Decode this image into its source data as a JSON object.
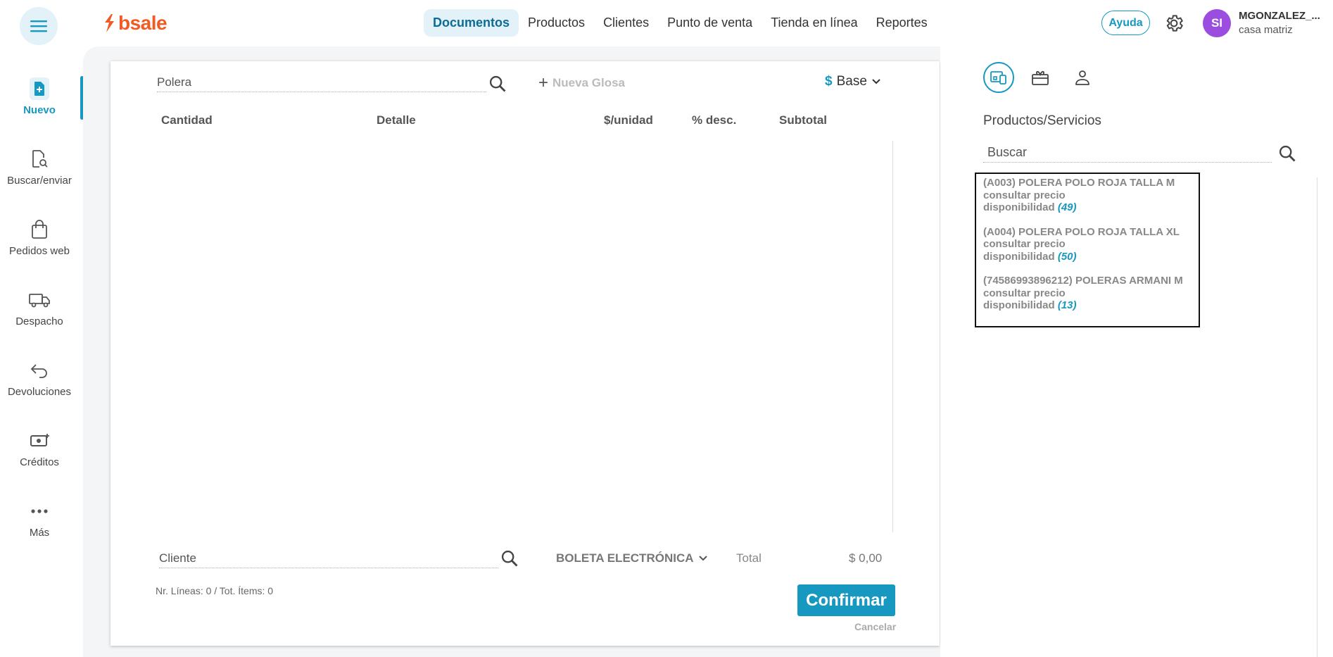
{
  "brand": {
    "name": "bsale"
  },
  "nav": {
    "items": [
      {
        "label": "Documentos",
        "active": true
      },
      {
        "label": "Productos"
      },
      {
        "label": "Clientes"
      },
      {
        "label": "Punto de venta"
      },
      {
        "label": "Tienda en línea"
      },
      {
        "label": "Reportes"
      }
    ]
  },
  "header": {
    "help_label": "Ayuda",
    "avatar_initials": "SI",
    "user_name": "MGONZALEZ_...",
    "branch": "casa matriz"
  },
  "sidebar": {
    "items": [
      {
        "label": "Nuevo",
        "icon": "new-document-icon"
      },
      {
        "label": "Buscar/enviar",
        "icon": "search-document-icon"
      },
      {
        "label": "Pedidos web",
        "icon": "shopping-bag-icon"
      },
      {
        "label": "Despacho",
        "icon": "truck-icon"
      },
      {
        "label": "Devoluciones",
        "icon": "return-arrow-icon"
      },
      {
        "label": "Créditos",
        "icon": "cash-credit-icon"
      },
      {
        "label": "Más",
        "icon": "more-dots-icon"
      }
    ]
  },
  "document": {
    "product_search_value": "Polera",
    "new_glosa_label": "Nueva Glosa",
    "price_list_symbol": "$",
    "price_list_label": "Base",
    "columns": [
      "Cantidad",
      "Detalle",
      "$/unidad",
      "% desc.",
      "Subtotal"
    ],
    "client_placeholder": "Cliente",
    "doc_type": "BOLETA ELECTRÓNICA",
    "total_label": "Total",
    "total_value": "$ 0,00",
    "lines_info": "Nr. Líneas: 0 / Tot. Ítems: 0",
    "confirm_label": "Confirmar",
    "cancel_label": "Cancelar"
  },
  "right_panel": {
    "title": "Productos/Servicios",
    "search_placeholder": "Buscar",
    "results": [
      {
        "name": "(A003) POLERA POLO ROJA TALLA M",
        "price": "consultar precio",
        "availability_label": "disponibilidad",
        "qty": "(49)"
      },
      {
        "name": "(A004) POLERA POLO ROJA TALLA XL",
        "price": "consultar precio",
        "availability_label": "disponibilidad",
        "qty": "(50)"
      },
      {
        "name": "(74586993896212) POLERAS ARMANI M",
        "price": "consultar precio",
        "availability_label": "disponibilidad",
        "qty": "(13)"
      }
    ]
  },
  "colors": {
    "accent": "#1798c1",
    "brand": "#f15a22",
    "avatar": "#9b4de0"
  }
}
